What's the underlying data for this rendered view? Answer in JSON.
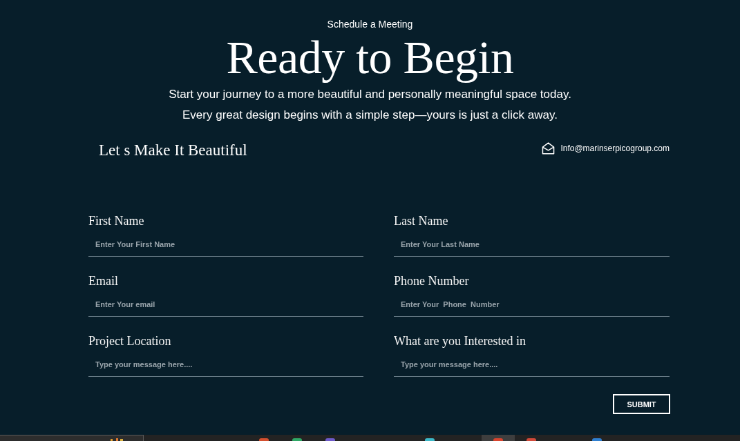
{
  "header": {
    "eyebrow": "Schedule a Meeting",
    "title": "Ready to Begin",
    "intro": [
      "Start your journey to a more beautiful and personally meaningful space today.",
      "Every great design begins with a simple step—yours is just a click away."
    ]
  },
  "contact_bar": {
    "tagline": "Let s Make It Beautiful",
    "email": "Info@marinserpicogroup.com"
  },
  "form": {
    "fields": [
      {
        "label": "First Name",
        "placeholder": "Enter Your First Name"
      },
      {
        "label": "Last Name",
        "placeholder": "Enter Your Last Name"
      },
      {
        "label": "Email",
        "placeholder": "Enter Your email"
      },
      {
        "label": "Phone Number",
        "placeholder": "Enter Your  Phone  Number"
      },
      {
        "label": "Project Location",
        "placeholder": "Type your message here...."
      },
      {
        "label": "What are you Interested in",
        "placeholder": "Type your message here...."
      }
    ],
    "submit": "SUBMIT"
  },
  "taskbar": {
    "apps": [
      {
        "color": "#d4502f",
        "selected": false
      },
      {
        "color": "#2fa866",
        "selected": false
      },
      {
        "color": "#6e5bc9",
        "selected": false
      },
      {
        "color": "#3cb8c8",
        "selected": false
      },
      {
        "color": "#d9452f",
        "selected": true
      },
      {
        "color": "#d24a3a",
        "selected": false
      },
      {
        "color": "#2f7fd0",
        "selected": false
      }
    ]
  }
}
